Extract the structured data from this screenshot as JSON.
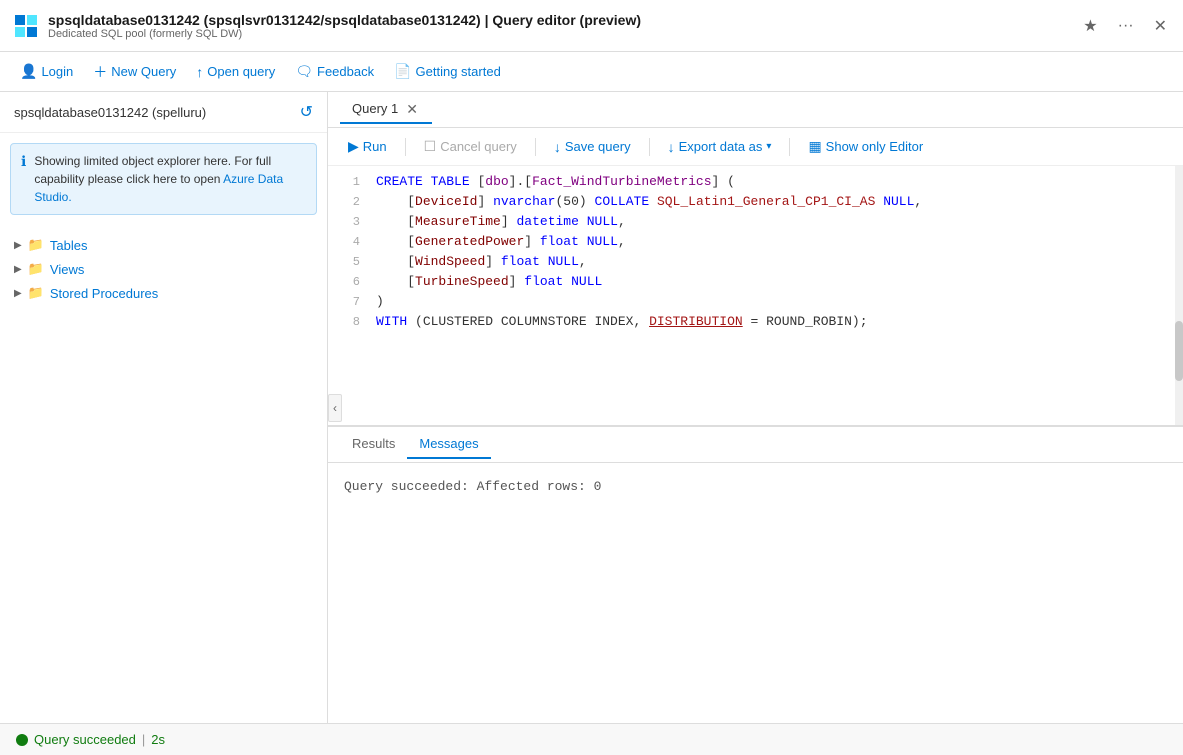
{
  "titleBar": {
    "title": "spsqldatabase0131242 (spsqlsvr0131242/spsqldatabase0131242) | Query editor (preview)",
    "subtitle": "Dedicated SQL pool (formerly SQL DW)",
    "starIcon": "★",
    "moreIcon": "···",
    "closeIcon": "✕"
  },
  "toolbar": {
    "loginLabel": "Login",
    "newQueryLabel": "New Query",
    "openQueryLabel": "Open query",
    "feedbackLabel": "Feedback",
    "gettingStartedLabel": "Getting started"
  },
  "sidebar": {
    "title": "spsqldatabase0131242 (spelluru)",
    "infoText": "Showing limited object explorer here. For full capability please click here to open Azure Data Studio.",
    "items": [
      {
        "label": "Tables"
      },
      {
        "label": "Views"
      },
      {
        "label": "Stored Procedures"
      }
    ]
  },
  "queryTab": {
    "label": "Query 1"
  },
  "editorToolbar": {
    "runLabel": "Run",
    "cancelLabel": "Cancel query",
    "saveLabel": "Save query",
    "exportLabel": "Export data as",
    "showEditorLabel": "Show only Editor"
  },
  "codeLines": [
    {
      "num": "1",
      "content": "CREATE TABLE [dbo].[Fact_WindTurbineMetrics] ("
    },
    {
      "num": "2",
      "content": "    [DeviceId] nvarchar(50) COLLATE SQL_Latin1_General_CP1_CI_AS NULL,"
    },
    {
      "num": "3",
      "content": "    [MeasureTime] datetime NULL,"
    },
    {
      "num": "4",
      "content": "    [GeneratedPower] float NULL,"
    },
    {
      "num": "5",
      "content": "    [WindSpeed] float NULL,"
    },
    {
      "num": "6",
      "content": "    [TurbineSpeed] float NULL"
    },
    {
      "num": "7",
      "content": ")"
    },
    {
      "num": "8",
      "content": "WITH (CLUSTERED COLUMNSTORE INDEX, DISTRIBUTION = ROUND_ROBIN);"
    }
  ],
  "resultsTabs": [
    {
      "label": "Results"
    },
    {
      "label": "Messages"
    }
  ],
  "resultsMessage": "Query succeeded: Affected rows: 0",
  "statusBar": {
    "successText": "Query succeeded",
    "durationText": "2s"
  }
}
